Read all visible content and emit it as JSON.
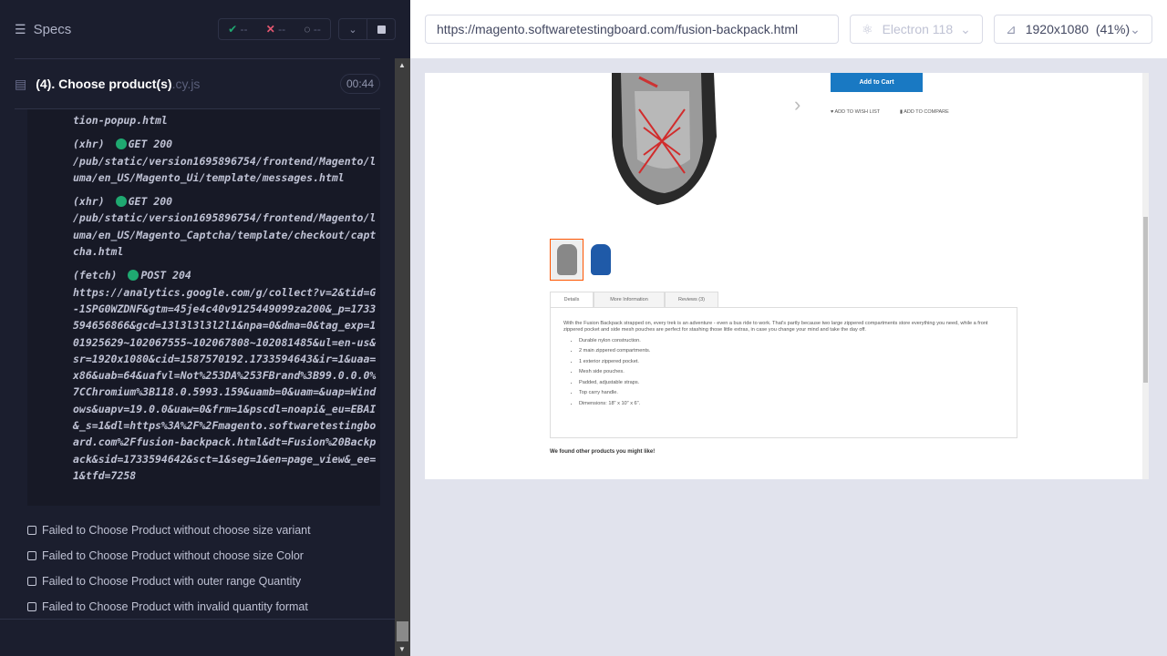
{
  "header": {
    "specs_label": "Specs",
    "passed": "--",
    "failed": "--",
    "pending": "--"
  },
  "spec": {
    "name": "(4). Choose product(s)",
    "ext": ".cy.js",
    "duration": "00:44"
  },
  "log": [
    {
      "type": "",
      "method": "",
      "url": "tion-popup.html"
    },
    {
      "type": "(xhr)",
      "method": "GET 200",
      "url": "/pub/static/version1695896754/frontend/Magento/luma/en_US/Magento_Ui/template/messages.html"
    },
    {
      "type": "(xhr)",
      "method": "GET 200",
      "url": "/pub/static/version1695896754/frontend/Magento/luma/en_US/Magento_Captcha/template/checkout/captcha.html"
    },
    {
      "type": "(fetch)",
      "method": "POST 204",
      "url": "https://analytics.google.com/g/collect?v=2&tid=G-1SPG0WZDNF&gtm=45je4c40v9125449099za200&_p=1733594656866&gcd=13l3l3l3l2l1&npa=0&dma=0&tag_exp=101925629~102067555~102067808~102081485&ul=en-us&sr=1920x1080&cid=1587570192.1733594643&ir=1&uaa=x86&uab=64&uafvl=Not%253DA%253FBrand%3B99.0.0.0%7CChromium%3B118.0.5993.159&uamb=0&uam=&uap=Windows&uapv=19.0.0&uaw=0&frm=1&pscdl=noapi&_eu=EBAI&_s=1&dl=https%3A%2F%2Fmagento.softwaretestingboard.com%2Ffusion-backpack.html&dt=Fusion%20Backpack&sid=1733594642&sct=1&seg=1&en=page_view&_ee=1&tfd=7258"
    }
  ],
  "tests": [
    "Failed to Choose Product without choose size variant",
    "Failed to Choose Product without choose size Color",
    "Failed to Choose Product with outer range Quantity",
    "Failed to Choose Product with invalid quantity format"
  ],
  "topbar": {
    "url": "https://magento.softwaretestingboard.com/fusion-backpack.html",
    "browser": "Electron 118",
    "viewport": "1920x1080",
    "scale": "(41%)"
  },
  "aut": {
    "add_to_cart": "Add to Cart",
    "wishlist": "ADD TO WISH LIST",
    "compare": "ADD TO COMPARE",
    "tabs": [
      "Details",
      "More Information",
      "Reviews (3)"
    ],
    "description": "With the Fusion Backpack strapped on, every trek is an adventure - even a bus ride to work. That's partly because two large zippered compartments store everything you need, while a front zippered pocket and side mesh pouches are perfect for stashing those little extras, in case you change your mind and take the day off.",
    "features": [
      "Durable nylon construction.",
      "2 main zippered compartments.",
      "1 exterior zippered pocket.",
      "Mesh side pouches.",
      "Padded, adjustable straps.",
      "Top carry handle.",
      "Dimensions: 18\" x 10\" x 6\"."
    ],
    "related": "We found other products you might like!"
  },
  "colors": {
    "pass": "#1fa971",
    "fail": "#e45770",
    "accent": "#1979c3"
  }
}
